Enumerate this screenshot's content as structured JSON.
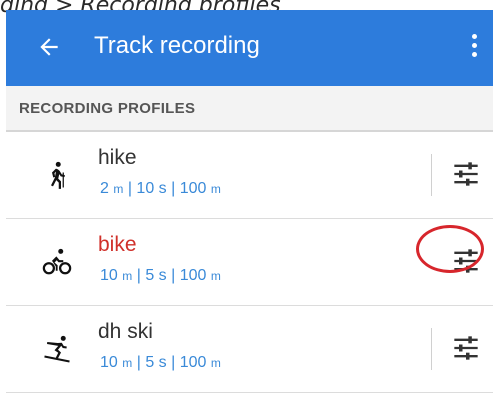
{
  "caption": "ding > Recording profiles",
  "appbar": {
    "title": "Track recording"
  },
  "section": {
    "header": "RECORDING PROFILES"
  },
  "profiles": [
    {
      "name": "hike",
      "icon": "hiker-icon",
      "dist1": "2",
      "unit1": "m",
      "time": "10",
      "time_unit": "s",
      "dist2": "100",
      "unit2": "m",
      "sep": "|"
    },
    {
      "name": "bike",
      "icon": "bike-icon",
      "dist1": "10",
      "unit1": "m",
      "time": "5",
      "time_unit": "s",
      "dist2": "100",
      "unit2": "m",
      "sep": "|"
    },
    {
      "name": "dh ski",
      "icon": "skier-icon",
      "dist1": "10",
      "unit1": "m",
      "time": "5",
      "time_unit": "s",
      "dist2": "100",
      "unit2": "m",
      "sep": "|"
    }
  ],
  "colors": {
    "appbar": "#2d7cdc",
    "active_name": "#d0302a",
    "info": "#3a8ad8",
    "highlight": "#d7262c"
  }
}
